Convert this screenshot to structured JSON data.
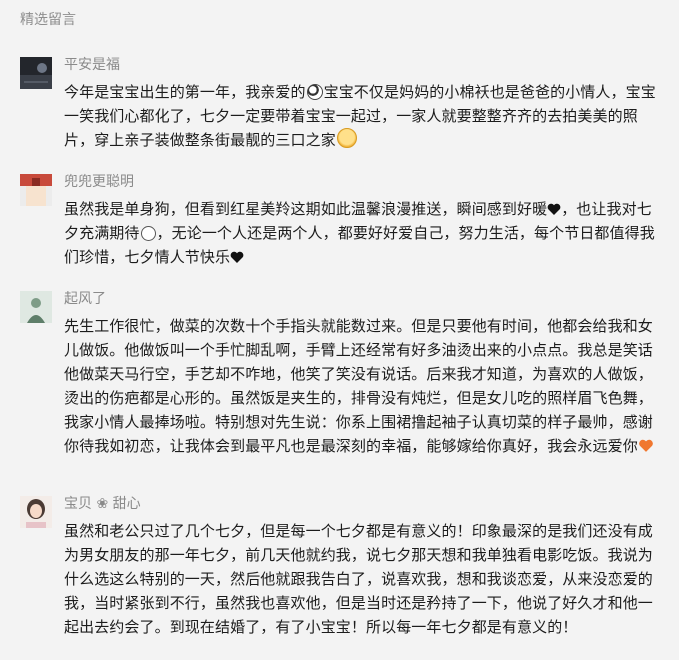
{
  "section": {
    "title": "精选留言"
  },
  "comments": [
    {
      "name": "平安是福",
      "text": [
        "今年是宝宝出生的第一年，我亲爱的",
        "宝宝不仅是妈妈的小棉袄也是爸爸的小情人，宝宝一笑我们心都化了，七夕一定要带着宝宝一起过，一家人就要整整齐齐的去拍美美的照片，穿上亲子装做整条街最靓的三口之家"
      ]
    },
    {
      "name": "兜兜更聪明",
      "text": [
        "虽然我是单身狗，但看到红星美羚这期如此温馨浪漫推送，瞬间感到好暖",
        "，也让我对七夕充满期待",
        "，无论一个人还是两个人，都要好好爱自己，努力生活，每个节日都值得我们珍惜，七夕情人节快乐"
      ]
    },
    {
      "name": "起风了",
      "text": [
        "先生工作很忙，做菜的次数十个手指头就能数过来。但是只要他有时间，他都会给我和女儿做饭。他做饭叫一个手忙脚乱啊，手臂上还经常有好多油烫出来的小点点。我总是笑话他做菜天马行空，手艺却不咋地，他笑了笑没有说话。后来我才知道，为喜欢的人做饭，烫出的伤疤都是心形的。虽然饭是夹生的，排骨没有炖烂，但是女儿吃的照样眉飞色舞，我家小情人最捧场啦。特别想对先生说：你系上围裙撸起袖子认真切菜的样子最帅，感谢你待我如初恋，让我体会到最平凡也是最深刻的幸福，能够嫁给你真好，我会永远爱你"
      ]
    },
    {
      "name": "宝贝 ❀ 甜心",
      "text": [
        "虽然和老公只过了几个七夕，但是每一个七夕都是有意义的！印象最深的是我们还没有成为男女朋友的那一年七夕，前几天他就约我，说七夕那天想和我单独看电影吃饭。我说为什么选这么特别的一天，然后他就跟我告白了，说喜欢我，想和我谈恋爱，从来没恋爱的我，当时紧张到不行，虽然我也喜欢他，但是当时还是矜持了一下，他说了好久才和他一起出去约会了。到现在结婚了，有了小宝宝！所以每一年七夕都是有意义的！"
      ]
    }
  ],
  "colors": {
    "background": "#f3f3f3",
    "nickname": "#8a8a8a",
    "heart_orange": "#f0772f"
  }
}
